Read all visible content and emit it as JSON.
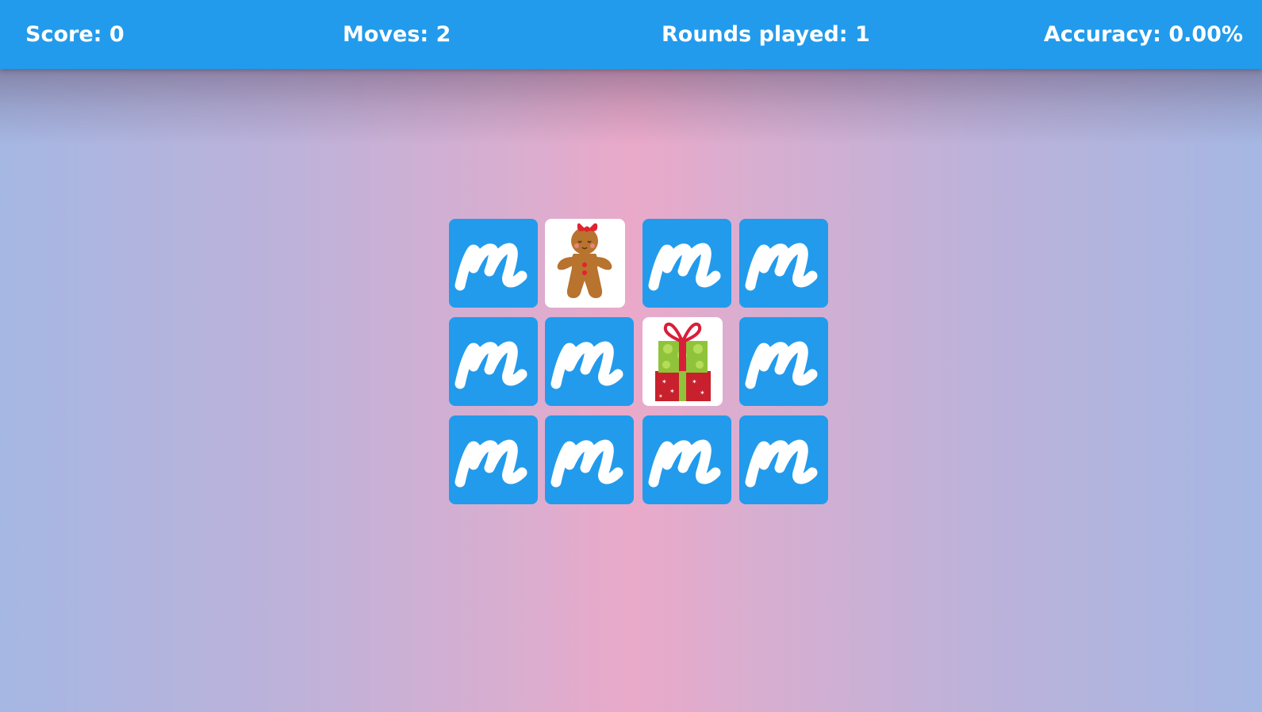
{
  "stats": {
    "score_text": "Score: 0",
    "moves_text": "Moves: 2",
    "rounds_text": "Rounds played: 1",
    "accuracy_text": "Accuracy: 0.00%"
  },
  "colors": {
    "topbar": "#229bec",
    "card_back": "#229bec",
    "card_face": "#ffffff"
  },
  "board": {
    "rows": 3,
    "columns": 4,
    "cards": [
      {
        "state": "face-down",
        "symbol": "m-logo-icon"
      },
      {
        "state": "face-up",
        "symbol": "gingerbread-girl-icon"
      },
      {
        "state": "face-down",
        "symbol": "m-logo-icon"
      },
      {
        "state": "face-down",
        "symbol": "m-logo-icon"
      },
      {
        "state": "face-down",
        "symbol": "m-logo-icon"
      },
      {
        "state": "face-down",
        "symbol": "m-logo-icon"
      },
      {
        "state": "face-up",
        "symbol": "gift-box-icon"
      },
      {
        "state": "face-down",
        "symbol": "m-logo-icon"
      },
      {
        "state": "face-down",
        "symbol": "m-logo-icon"
      },
      {
        "state": "face-down",
        "symbol": "m-logo-icon"
      },
      {
        "state": "face-down",
        "symbol": "m-logo-icon"
      },
      {
        "state": "face-down",
        "symbol": "m-logo-icon"
      }
    ]
  }
}
